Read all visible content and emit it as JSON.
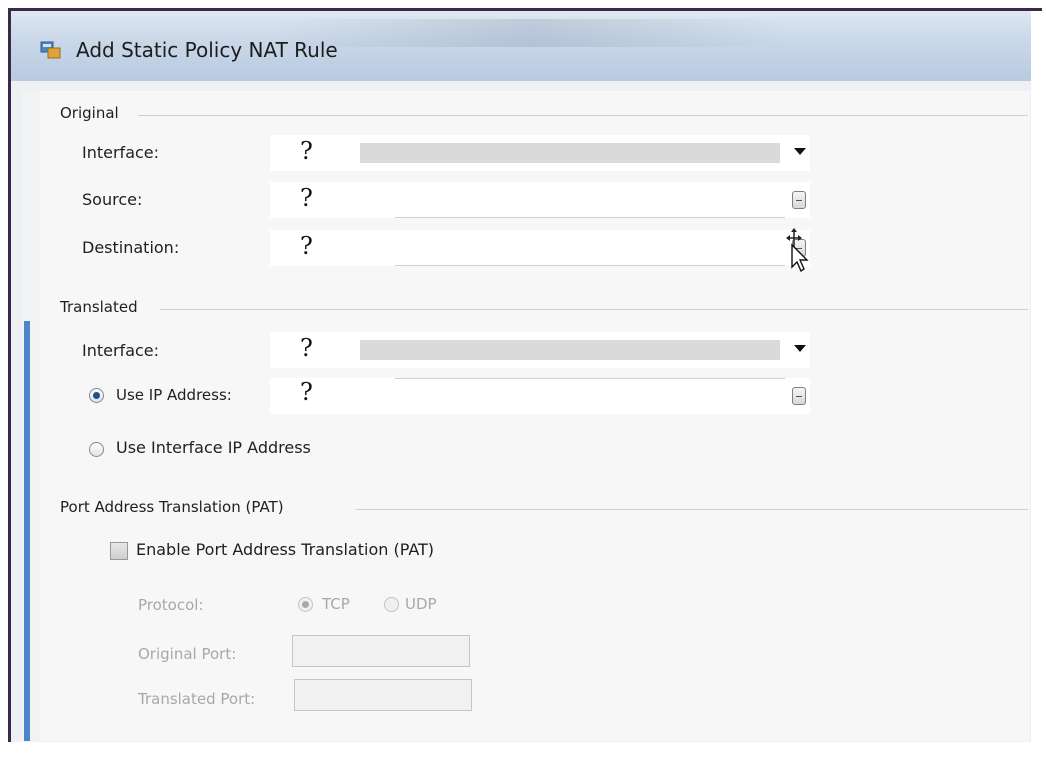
{
  "window": {
    "title": "Add Static Policy NAT Rule",
    "icon": "nat-rule-icon"
  },
  "original": {
    "group_title": "Original",
    "interface": {
      "label": "Interface:",
      "value": "?"
    },
    "source": {
      "label": "Source:",
      "value": "?"
    },
    "destination": {
      "label": "Destination:",
      "value": "?"
    }
  },
  "translated": {
    "group_title": "Translated",
    "interface": {
      "label": "Interface:",
      "value": "?"
    },
    "use_ip_address": {
      "label": "Use IP Address:",
      "value": "?",
      "selected": true
    },
    "use_interface_ip": {
      "label": "Use Interface IP Address",
      "selected": false
    }
  },
  "pat": {
    "group_title": "Port Address Translation (PAT)",
    "enable_label": "Enable Port Address Translation (PAT)",
    "enabled": false,
    "protocol_label": "Protocol:",
    "protocol_options": [
      "TCP",
      "UDP"
    ],
    "protocol_selected": "TCP",
    "original_port_label": "Original Port:",
    "original_port_value": "",
    "translated_port_label": "Translated Port:",
    "translated_port_value": ""
  },
  "colors": {
    "accent": "#4d86c6",
    "titlebar": "#c9d7e8",
    "disabled_text": "#a8a8a8"
  }
}
